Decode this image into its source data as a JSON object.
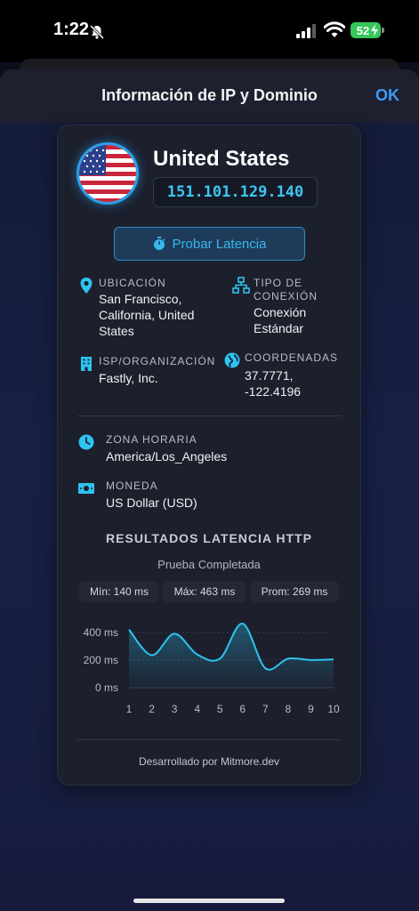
{
  "status_bar": {
    "time": "1:22",
    "battery": "52"
  },
  "nav": {
    "title": "Información de IP y Dominio",
    "ok_label": "OK"
  },
  "header": {
    "country": "United States",
    "ip": "151.101.129.140"
  },
  "latency_button": {
    "label": "Probar Latencia"
  },
  "details": {
    "location": {
      "label": "UBICACIÓN",
      "lines": [
        "San Francisco,",
        "California, United",
        "States"
      ]
    },
    "connection": {
      "label_lines": [
        "TIPO DE",
        "CONEXIÓN"
      ],
      "lines": [
        "Conexión",
        "Estándar"
      ]
    },
    "isp": {
      "label": "ISP/ORGANIZACIÓN",
      "value": "Fastly, Inc."
    },
    "coords": {
      "label": "COORDENADAS",
      "lines": [
        "37.7771,",
        "-122.4196"
      ]
    },
    "timezone": {
      "label": "ZONA HORARIA",
      "value": "America/Los_Angeles"
    },
    "currency": {
      "label": "MONEDA",
      "value": "US Dollar (USD)"
    }
  },
  "results": {
    "title": "RESULTADOS LATENCIA HTTP",
    "subtitle": "Prueba Completada",
    "min": "Mín: 140 ms",
    "max": "Máx: 463 ms",
    "avg": "Prom: 269 ms"
  },
  "chart_data": {
    "type": "area",
    "x": [
      1,
      2,
      3,
      4,
      5,
      6,
      7,
      8,
      9,
      10
    ],
    "values": [
      420,
      235,
      390,
      240,
      210,
      463,
      140,
      210,
      200,
      205
    ],
    "yticks": [
      "0 ms",
      "200 ms",
      "400 ms"
    ],
    "ytick_values": [
      0,
      200,
      400
    ],
    "xticks": [
      "1",
      "2",
      "3",
      "4",
      "5",
      "6",
      "7",
      "8",
      "9",
      "10"
    ],
    "ylim": [
      0,
      463
    ],
    "line_color": "#2ec3f0",
    "grid": true
  },
  "footer": {
    "text": "Desarrollado por Mitmore.dev"
  }
}
